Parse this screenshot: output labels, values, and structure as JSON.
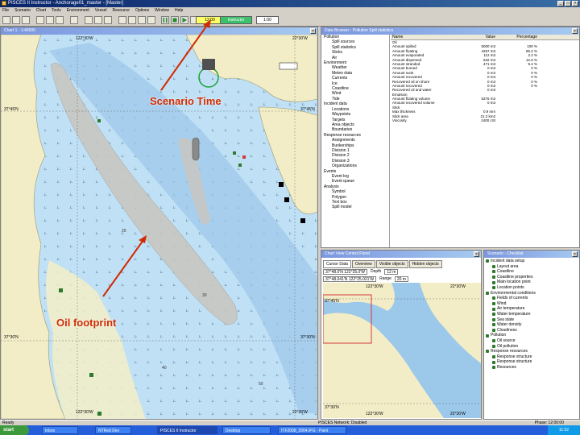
{
  "window": {
    "title": "PISCES II Instructor - Anchorage01_master - [Master]"
  },
  "menu": [
    "File",
    "Scenario",
    "Chart",
    "Tools",
    "Environment",
    "Vessel",
    "Resource",
    "Options",
    "Window",
    "Help"
  ],
  "toolbar": {
    "scenario_time": "12:00",
    "mode_button": "Instructor",
    "speed_field": "1:00"
  },
  "chart": {
    "title": "Chart 1 - 1:40000",
    "coords": {
      "top_lon": "122°30'W",
      "top_right": "22°30'W",
      "left_lat": "37°45'N",
      "bottom_lat": "37°30'N",
      "bottom_lon": "122°30'W",
      "bottom_right": "22°30'W",
      "right_lat": "37°45'N",
      "right_lat_low": "37°30'N"
    },
    "depth_labels": [
      "20",
      "30",
      "40",
      "50"
    ]
  },
  "data_browser": {
    "title": "Data Browser - Pollution Spill statistics",
    "tree": [
      "Pollution",
      "Spill sources",
      "Spill statistics",
      "Slicks",
      "Air",
      "Environment",
      "Weather",
      "Meteo data",
      "Currents",
      "Ice",
      "Coastline",
      "Wind",
      "Tide",
      "Incident data",
      "Locations",
      "Waypoints",
      "Targets",
      "Area objects",
      "Boundaries",
      "Response resources",
      "Assignments",
      "Bunkerships",
      "Division 1",
      "Division 2",
      "Division 3",
      "Organizations",
      "Events",
      "Event log",
      "Event queue",
      "Analysis",
      "Symbol",
      "Polygon",
      "Text box",
      "Spill model"
    ],
    "columns": [
      "Name",
      "Value",
      "Percentage"
    ],
    "rows": [
      {
        "name": "Oil",
        "value": "",
        "pct": ""
      },
      {
        "name": "Amount spilled",
        "value": "5000 m3",
        "pct": "100 %"
      },
      {
        "name": "Amount floating",
        "value": "4257 m3",
        "pct": "85.2 %"
      },
      {
        "name": "Amount evaporated",
        "value": "112 m3",
        "pct": "2.2 %"
      },
      {
        "name": "Amount dispersed",
        "value": "632 m3",
        "pct": "12.6 %"
      },
      {
        "name": "Amount stranded",
        "value": "471 m3",
        "pct": "9.4 %"
      },
      {
        "name": "Amount burned",
        "value": "0 m3",
        "pct": "0 %"
      },
      {
        "name": "Amount sunk",
        "value": "0 m3",
        "pct": "0 %"
      },
      {
        "name": "Amount recovered",
        "value": "0 m3",
        "pct": "0 %"
      },
      {
        "name": "Recovered oil on shore",
        "value": "0 m3",
        "pct": "0 %"
      },
      {
        "name": "Amount recovered",
        "value": "0 m3",
        "pct": "0 %"
      },
      {
        "name": "Recovered oil and water",
        "value": "0 m3",
        "pct": ""
      },
      {
        "name": "Emulsion",
        "value": "",
        "pct": ""
      },
      {
        "name": "Amount floating volume",
        "value": "6275 m3",
        "pct": ""
      },
      {
        "name": "Amount recovered volume",
        "value": "0 m3",
        "pct": ""
      },
      {
        "name": "Slick",
        "value": "",
        "pct": ""
      },
      {
        "name": "Max thickness",
        "value": "0.9 mm",
        "pct": ""
      },
      {
        "name": "Slick area",
        "value": "21.2 km2",
        "pct": ""
      },
      {
        "name": "Viscosity",
        "value": "2400 cSt",
        "pct": ""
      }
    ]
  },
  "overview": {
    "title": "Chart View Control Panel",
    "tabs": [
      "Cursor Data",
      "Overview",
      "Visible objects",
      "Hidden objects"
    ],
    "readout_1": "37°48.0'N  122°25.0'W",
    "readout_2": "37°48.041'N  122°25.021'W",
    "depth_label": "Depth",
    "depth_value": "12 m",
    "range_label": "Range",
    "range_value": "20 m",
    "lat_top": "37°45'N",
    "lat_bottom": "37°30'N",
    "lon_top": "122°30'W",
    "lon_top_right": "22°30'W",
    "lon_bottom": "122°30'W",
    "lon_bottom_right": "22°30'W"
  },
  "checklist": {
    "title": "Scenario - Checklist",
    "items": [
      "Incident data setup",
      "Layout area",
      "Coastline",
      "Coastline properties",
      "Main location point",
      "Location points",
      "Environmental conditions",
      "Fields of currents",
      "Wind",
      "Air temperature",
      "Water temperature",
      "Sea state",
      "Water density",
      "Cloudiness",
      "Pollution",
      "Oil source",
      "Oil pollution",
      "Response resources",
      "Response structure",
      "Response structure",
      "Resources"
    ]
  },
  "status": {
    "left": "Ready",
    "mid": "PISCES Network: Disabled",
    "right": "Phase: 12:00:00"
  },
  "taskbar": {
    "start": "start",
    "tasks": [
      "Inbox",
      "NTRed Dev",
      "PISCES II Instructor",
      "Desktop",
      "ITF2008_2004.IPG - Paint"
    ],
    "clock": "11:52"
  },
  "annotations": {
    "scenario_time": "Scenario Time",
    "oil_footprint": "Oil footprint"
  },
  "colors": {
    "sea": "#bfe0f5",
    "land": "#f3edc7",
    "shallow": "#9cc8ea",
    "slick": "#c9c6c0",
    "annotation": "#d12b00",
    "title_bar": "#0a246a"
  }
}
